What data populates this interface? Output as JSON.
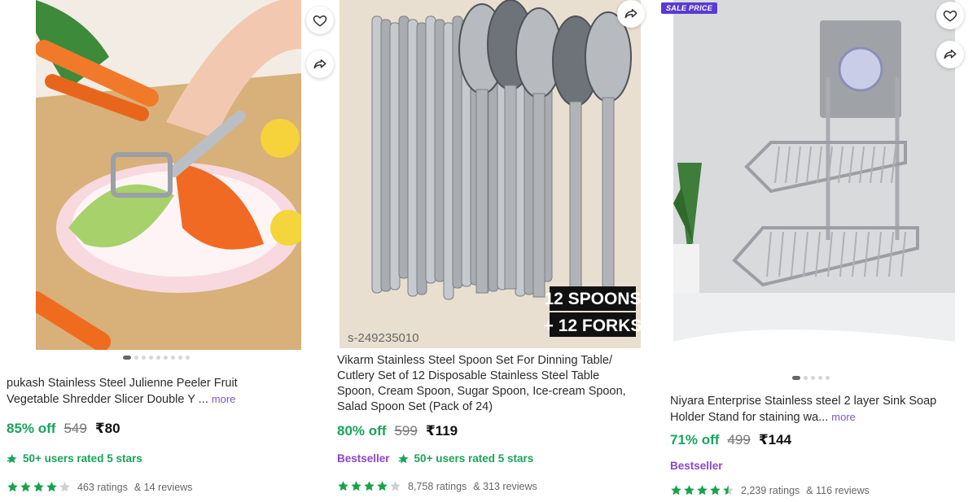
{
  "products": [
    {
      "title_line1": "pukash Stainless Steel Julienne Peeler Fruit",
      "title_line2": "Vegetable Shredder Slicer Double Y ...",
      "more_label": "more",
      "discount": "85% off",
      "mrp": "549",
      "price": "₹80",
      "users_rated": "50+ users rated 5 stars",
      "rating_value": 4,
      "ratings": "463 ratings",
      "reviews": "& 14 reviews",
      "image_dots": 9,
      "active_dot": 0
    },
    {
      "title_line1": "Vikarm Stainless Steel Spoon Set For Dinning Table/",
      "title_line2": "Cutlery Set of 12 Disposable Stainless Steel Table",
      "title_line3": "Spoon, Cream Spoon, Sugar Spoon, Ice-cream Spoon,",
      "title_line4": "Salad Spoon Set (Pack of 24)",
      "discount": "80% off",
      "mrp": "599",
      "price": "₹119",
      "bestseller": "Bestseller",
      "users_rated": "50+ users rated 5 stars",
      "rating_value": 4,
      "ratings": "8,758 ratings",
      "reviews": "& 313 reviews",
      "image_text_1": "12 SPOONS",
      "image_text_2": "+ 12 FORKS",
      "image_code": "s-249235010"
    },
    {
      "sale_tag": "SALE PRICE",
      "title_line1": "Niyara Enterprise Stainless steel 2 layer Sink Soap",
      "title_line2": "Holder Stand for staining wa...",
      "more_label": "more",
      "discount": "71% off",
      "mrp": "499",
      "price": "₹144",
      "bestseller": "Bestseller",
      "rating_value": 4.5,
      "ratings": "2,239 ratings",
      "reviews": "& 116 reviews",
      "image_dots": 5,
      "active_dot": 0
    }
  ],
  "icons": {
    "wishlist": "heart-icon",
    "share": "share-icon",
    "star": "star-icon",
    "badge": "star-badge-icon"
  },
  "colors": {
    "discount": "#1aa45a",
    "star": "#16a34a",
    "bestseller": "#8e44c9",
    "more": "#7e57c2",
    "sale_tag": "#5a3bd1"
  }
}
